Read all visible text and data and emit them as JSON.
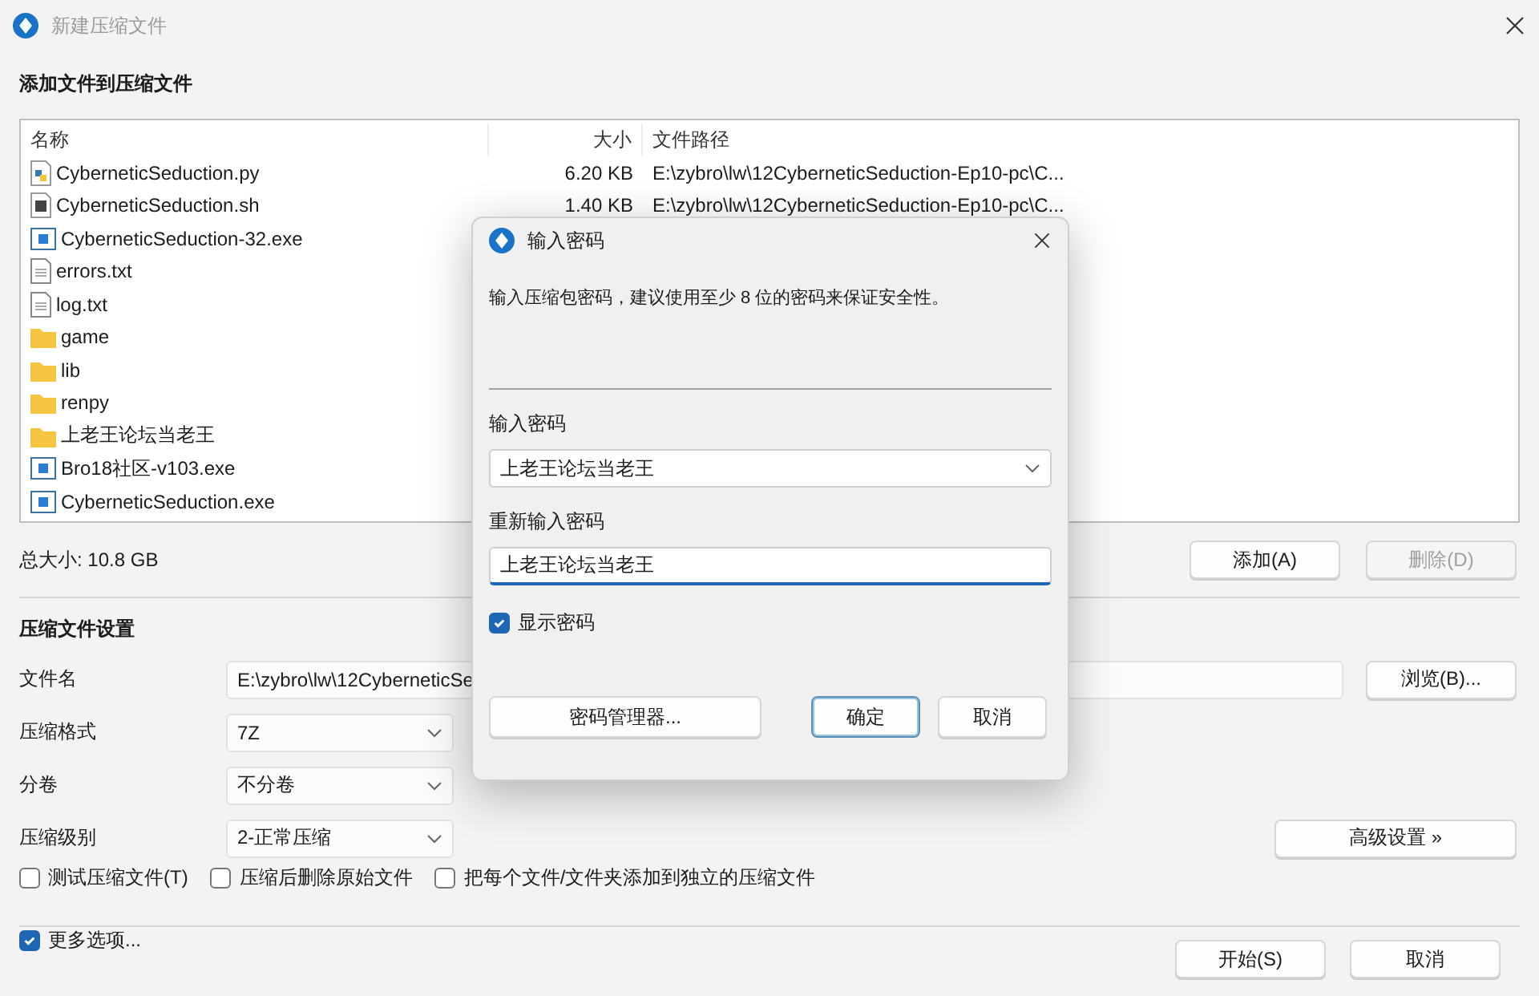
{
  "window": {
    "title": "新建压缩文件"
  },
  "files_section": {
    "heading": "添加文件到压缩文件",
    "columns": [
      "名称",
      "大小",
      "文件路径"
    ],
    "rows": [
      {
        "kind": "python",
        "name": "CyberneticSeduction.py",
        "size": "6.20 KB",
        "path": "E:\\zybro\\lw\\12CyberneticSeduction-Ep10-pc\\C..."
      },
      {
        "kind": "script",
        "name": "CyberneticSeduction.sh",
        "size": "1.40 KB",
        "path": "E:\\zybro\\lw\\12CyberneticSeduction-Ep10-pc\\C..."
      },
      {
        "kind": "exe",
        "name": "CyberneticSeduction-32.exe"
      },
      {
        "kind": "text",
        "name": "errors.txt"
      },
      {
        "kind": "text",
        "name": "log.txt"
      },
      {
        "kind": "folder",
        "name": "game"
      },
      {
        "kind": "folder",
        "name": "lib"
      },
      {
        "kind": "folder",
        "name": "renpy"
      },
      {
        "kind": "folder",
        "name": "上老王论坛当老王"
      },
      {
        "kind": "exe",
        "name": "Bro18社区-v103.exe"
      },
      {
        "kind": "exe",
        "name": "CyberneticSeduction.exe"
      }
    ],
    "total": "总大小: 10.8 GB",
    "buttons": [
      {
        "label": "添加(A)",
        "disabled": false
      },
      {
        "label": "删除(D)",
        "disabled": true
      }
    ]
  },
  "settings": {
    "heading": "压缩文件设置",
    "filename": {
      "label": "文件名",
      "value": "E:\\zybro\\lw\\12CyberneticSe",
      "browse": "浏览(B)..."
    },
    "format": {
      "label": "压缩格式",
      "value": "7Z"
    },
    "split": {
      "label": "分卷",
      "value": "不分卷"
    },
    "level": {
      "label": "压缩级别",
      "value": "2-正常压缩",
      "advanced": "高级设置 »"
    },
    "options": [
      {
        "label": "测试压缩文件(T)",
        "checked": false
      },
      {
        "label": "压缩后删除原始文件",
        "checked": false
      },
      {
        "label": "把每个文件/文件夹添加到独立的压缩文件",
        "checked": false
      }
    ]
  },
  "footer": {
    "more": {
      "label": "更多选项...",
      "checked": true
    },
    "buttons": [
      "开始(S)",
      "取消"
    ]
  },
  "password_dialog": {
    "title": "输入密码",
    "description": "输入压缩包密码，建议使用至少 8 位的密码来保证安全性。",
    "password_label": "输入密码",
    "password_value": "上老王论坛当老王",
    "confirm_label": "重新输入密码",
    "confirm_value": "上老王论坛当老王",
    "show_password": {
      "label": "显示密码",
      "checked": true
    },
    "buttons": [
      {
        "label": "密码管理器...",
        "default": false
      },
      {
        "label": "确定",
        "default": true
      },
      {
        "label": "取消",
        "default": false
      }
    ]
  }
}
